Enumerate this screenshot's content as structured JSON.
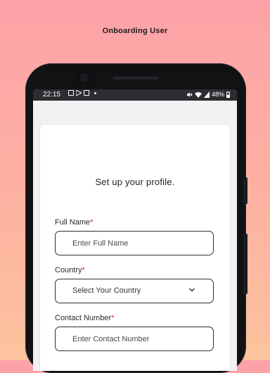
{
  "caption": "Onboarding User",
  "status_bar": {
    "time": "22:15",
    "battery": "48%"
  },
  "form": {
    "title": "Set up your profile.",
    "full_name": {
      "label": "Full Name",
      "required_mark": "*",
      "placeholder": "Enter Full Name"
    },
    "country": {
      "label": "Country",
      "required_mark": "*",
      "selected": "Select Your Country"
    },
    "contact_number": {
      "label": "Contact Number",
      "required_mark": "*",
      "placeholder": "Enter Contact Number"
    }
  },
  "colors": {
    "background_top": "#fda2a8",
    "background_bottom": "#fdc39e",
    "required": "#c62828",
    "status_bar": "#2b2d31"
  },
  "icons": [
    "photo-icon",
    "send-icon",
    "image-icon",
    "mute-icon",
    "wifi-icon",
    "signal-icon",
    "chevron-down-icon"
  ]
}
